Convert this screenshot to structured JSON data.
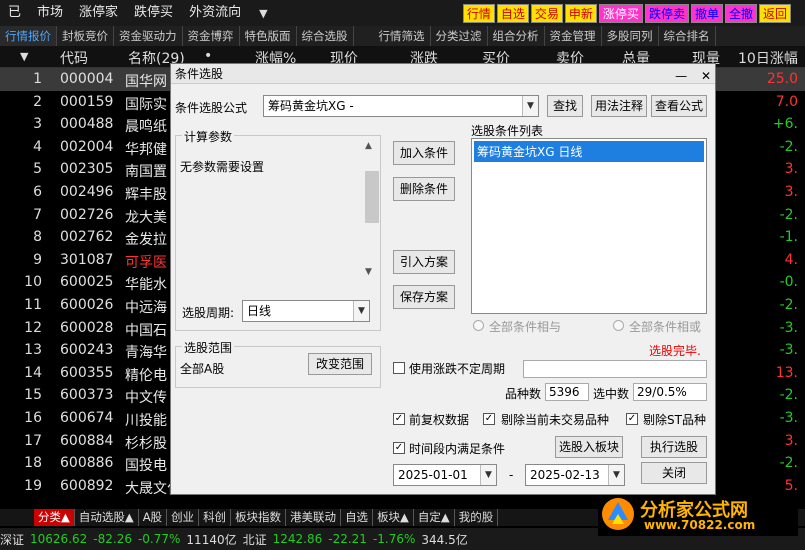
{
  "menubar": {
    "items": [
      "已",
      "市场",
      "涨停家",
      "跌停买",
      "外资流向"
    ],
    "quick": [
      {
        "label": "行情",
        "bg": "#ffe000",
        "fg": "#c00"
      },
      {
        "label": "自选",
        "bg": "#ffe000",
        "fg": "#c00"
      },
      {
        "label": "交易",
        "bg": "#ffe000",
        "fg": "#c00"
      },
      {
        "label": "申新",
        "bg": "#ffe000",
        "fg": "#c00"
      },
      {
        "label": "涨停买",
        "bg": "#ff33cc",
        "fg": "#fff"
      },
      {
        "label": "跌停卖",
        "bg": "#ff33cc",
        "fg": "#00f"
      },
      {
        "label": "撤单",
        "bg": "#ff33cc",
        "fg": "#00f"
      },
      {
        "label": "全撤",
        "bg": "#ff33cc",
        "fg": "#00f"
      },
      {
        "label": "返回",
        "bg": "#ffe000",
        "fg": "#c00"
      }
    ]
  },
  "tabs": [
    "行情报价",
    "封板竞价",
    "资金驱动力",
    "资金博弈",
    "特色版面",
    "综合选股",
    "行情筛选",
    "分类过滤",
    "组合分析",
    "资金管理",
    "多股同列",
    "综合排名"
  ],
  "header": {
    "arrow": "▼",
    "code": "代码",
    "name": "名称(29)",
    "dot": "•",
    "pct": "涨幅%",
    "price": "现价",
    "chg": "涨跌",
    "buy": "买价",
    "sell": "卖价",
    "vol": "总量",
    "cur": "现量",
    "pct10": "10日涨幅"
  },
  "rows": [
    {
      "idx": "1",
      "code": "000004",
      "name": "国华网",
      "val": "25.0",
      "nc": "#e8e8e8",
      "vc": "red"
    },
    {
      "idx": "2",
      "code": "000159",
      "name": "国际实",
      "val": "7.0",
      "nc": "#e8e8e8",
      "vc": "red"
    },
    {
      "idx": "3",
      "code": "000488",
      "name": "晨鸣纸",
      "val": "+6.",
      "nc": "#e8e8e8",
      "vc": "grn"
    },
    {
      "idx": "4",
      "code": "002004",
      "name": "华邦健",
      "val": "-2.",
      "nc": "#e8e8e8",
      "vc": "grn"
    },
    {
      "idx": "5",
      "code": "002305",
      "name": "南国置",
      "val": "3.",
      "nc": "#e8e8e8",
      "vc": "red"
    },
    {
      "idx": "6",
      "code": "002496",
      "name": "辉丰股",
      "val": "3.",
      "nc": "#e8e8e8",
      "vc": "red"
    },
    {
      "idx": "7",
      "code": "002726",
      "name": "龙大美",
      "val": "-2.",
      "nc": "#e8e8e8",
      "vc": "grn"
    },
    {
      "idx": "8",
      "code": "002762",
      "name": "金发拉",
      "val": "-1.",
      "nc": "#e8e8e8",
      "vc": "grn"
    },
    {
      "idx": "9",
      "code": "301087",
      "name": "可孚医",
      "val": "4.",
      "nc": "#ff3333",
      "vc": "red"
    },
    {
      "idx": "10",
      "code": "600025",
      "name": "华能水",
      "val": "-0.",
      "nc": "#e8e8e8",
      "vc": "grn"
    },
    {
      "idx": "11",
      "code": "600026",
      "name": "中远海",
      "val": "-2.",
      "nc": "#e8e8e8",
      "vc": "grn"
    },
    {
      "idx": "12",
      "code": "600028",
      "name": "中国石",
      "val": "-3.",
      "nc": "#e8e8e8",
      "vc": "grn"
    },
    {
      "idx": "13",
      "code": "600243",
      "name": "青海华",
      "val": "-3.",
      "nc": "#e8e8e8",
      "vc": "grn"
    },
    {
      "idx": "14",
      "code": "600355",
      "name": "精伦电",
      "val": "13.",
      "nc": "#e8e8e8",
      "vc": "red"
    },
    {
      "idx": "15",
      "code": "600373",
      "name": "中文传",
      "val": "-2.",
      "nc": "#e8e8e8",
      "vc": "grn"
    },
    {
      "idx": "16",
      "code": "600674",
      "name": "川投能",
      "val": "-3.",
      "nc": "#e8e8e8",
      "vc": "grn"
    },
    {
      "idx": "17",
      "code": "600884",
      "name": "杉杉股",
      "val": "3.",
      "nc": "#e8e8e8",
      "vc": "red"
    },
    {
      "idx": "18",
      "code": "600886",
      "name": "国投电",
      "val": "-2.",
      "nc": "#e8e8e8",
      "vc": "grn"
    },
    {
      "idx": "19",
      "code": "600892",
      "name": "大晟文化",
      "val": "5.",
      "nc": "#e8e8e8",
      "vc": "red"
    }
  ],
  "bottom_tabs": [
    "分类▲",
    "自动选股▲",
    "A股",
    "创业",
    "科创",
    "板块指数",
    "港美联动",
    "自选",
    "板块▲",
    "自定▲",
    "我的股"
  ],
  "status": [
    {
      "t": "深证",
      "c": "#ddd"
    },
    {
      "t": "10626.62",
      "c": "#2c2"
    },
    {
      "t": "-82.26",
      "c": "#2c2"
    },
    {
      "t": "-0.77%",
      "c": "#2c2"
    },
    {
      "t": "11140亿",
      "c": "#ddd"
    },
    {
      "t": "北证",
      "c": "#ddd"
    },
    {
      "t": "1242.86",
      "c": "#2c2"
    },
    {
      "t": "-22.21",
      "c": "#2c2"
    },
    {
      "t": "-1.76%",
      "c": "#2c2"
    },
    {
      "t": "344.5亿",
      "c": "#ddd"
    }
  ],
  "logo": {
    "text": "分析家公式网",
    "url": "www.70822.com"
  },
  "dialog": {
    "title": "条件选股",
    "formula_label": "条件选股公式",
    "formula_value": "筹码黄金坑XG  -",
    "btn_find": "查找",
    "btn_usage": "用法注释",
    "btn_view": "查看公式",
    "calc_group": "计算参数",
    "no_params": "无参数需要设置",
    "btn_add": "加入条件",
    "btn_del": "删除条件",
    "btn_import": "引入方案",
    "btn_save": "保存方案",
    "cond_list_label": "选股条件列表",
    "cond_item": "筹码黄金坑XG  日线",
    "radio_and": "全部条件相与",
    "radio_or": "全部条件相或",
    "period_label": "选股周期:",
    "period_value": "日线",
    "range_group": "选股范围",
    "range_value": "全部A股",
    "btn_range": "改变范围",
    "done": "选股完毕.",
    "chk_uncertain": "使用涨跌不定周期",
    "count_label": "品种数",
    "count_value": "5396",
    "selected_label": "选中数",
    "selected_value": "29/0.5%",
    "chk_adjust": "前复权数据",
    "chk_exclude_nontrade": "剔除当前未交易品种",
    "chk_exclude_st": "剔除ST品种",
    "chk_timerange": "时间段内满足条件",
    "btn_to_block": "选股入板块",
    "btn_exec": "执行选股",
    "date_from": "2025-01-01",
    "date_sep": "-",
    "date_to": "2025-02-13",
    "btn_close": "关闭",
    "close_icon": "✕",
    "min_icon": "—"
  }
}
